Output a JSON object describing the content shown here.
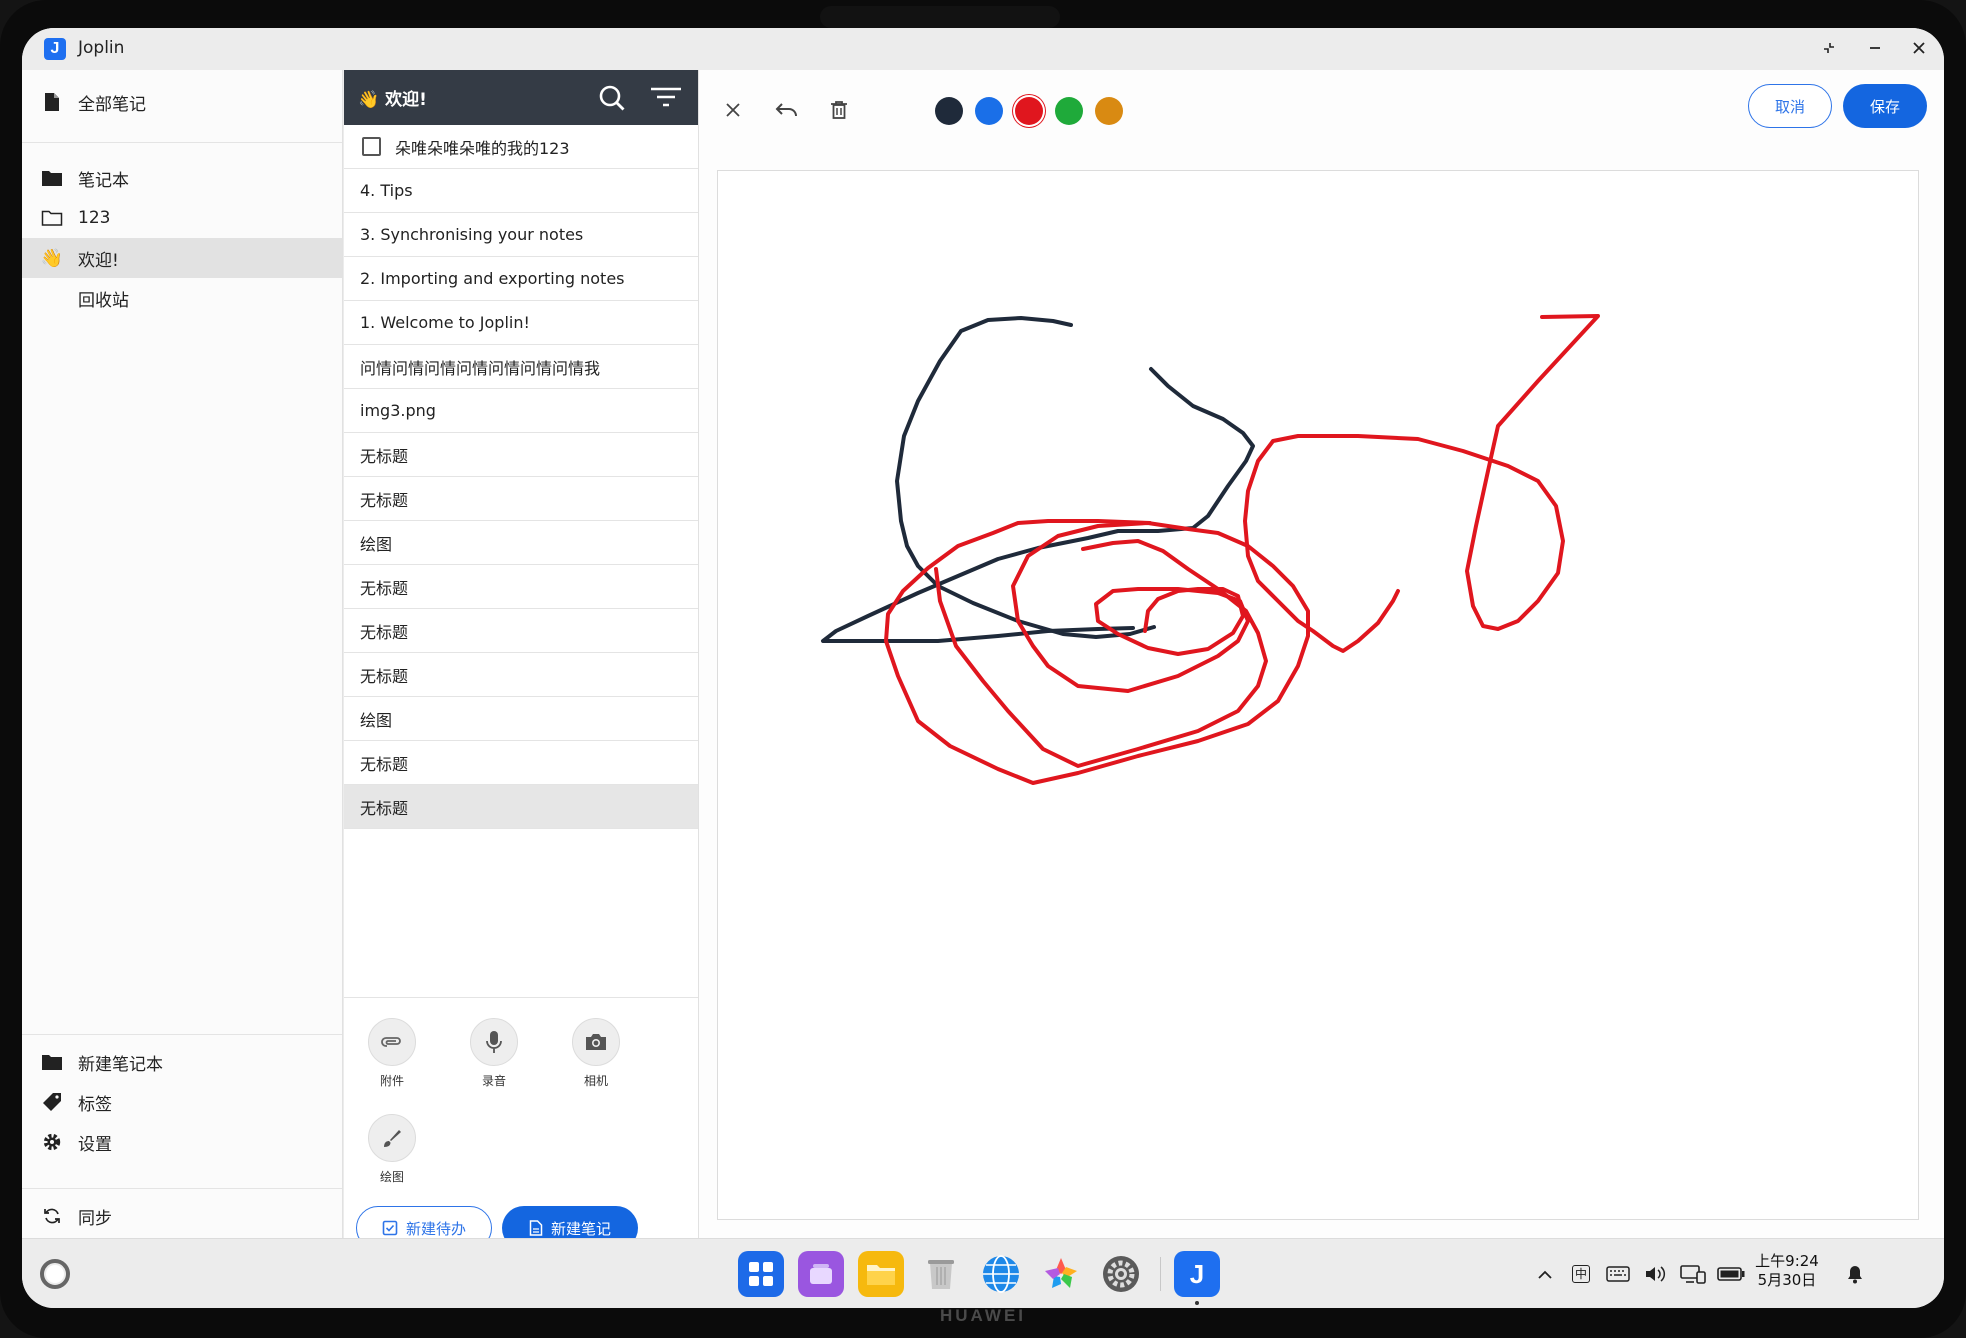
{
  "window": {
    "title": "Joplin",
    "logo": "J"
  },
  "sidebar": {
    "all_notes": "全部笔记",
    "notebooks_header": "笔记本",
    "notebooks": [
      {
        "label": "123",
        "icon": "folder-outline-icon"
      },
      {
        "label": "欢迎!",
        "icon": "wave-emoji-icon",
        "active": true
      },
      {
        "label": "回收站",
        "icon": "none"
      }
    ],
    "new_notebook": "新建笔记本",
    "tags": "标签",
    "settings": "设置",
    "sync": "同步"
  },
  "note_list": {
    "title": "👋 欢迎!",
    "todo_item": "朵唯朵唯朵唯的我的123",
    "notes": [
      "4. Tips",
      "3. Synchronising your notes",
      "2. Importing and exporting notes",
      "1. Welcome to Joplin!",
      "问情问情问情问情问情问情问情我",
      "img3.png",
      "无标题",
      "无标题",
      "绘图",
      "无标题",
      "无标题",
      "无标题",
      "绘图",
      "无标题",
      "无标题"
    ],
    "selected_index": 14,
    "actions": {
      "attach": "附件",
      "record": "录音",
      "camera": "相机",
      "draw": "绘图"
    },
    "new_todo": "新建待办",
    "new_note": "新建笔记"
  },
  "editor": {
    "cancel": "取消",
    "save": "保存",
    "colors": [
      "#1f2a3a",
      "#1a6fe8",
      "#e0161e",
      "#1faa3a",
      "#d98a12"
    ],
    "selected_color": "#e0161e"
  },
  "taskbar": {
    "ime": "中",
    "clock_time": "上午9:24",
    "clock_date": "5月30日"
  },
  "device": {
    "brand": "HUAWEI"
  }
}
